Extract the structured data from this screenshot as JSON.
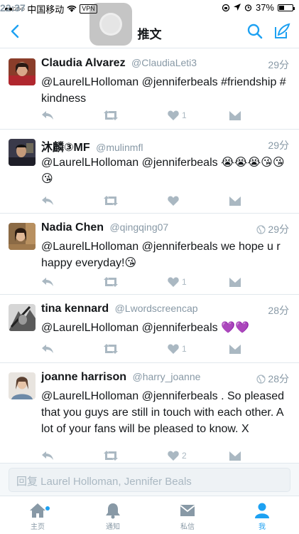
{
  "status_bar": {
    "signal": "●●○○○",
    "carrier": "中国移动",
    "vpn": "VPN",
    "time": "22:37",
    "battery_text": "37%",
    "battery_level": 0.37
  },
  "nav": {
    "title": "推文",
    "accent_color": "#1da1f2"
  },
  "tweets": [
    {
      "name": "Claudia Alvarez",
      "handle": "@ClaudiaLeti3",
      "time": "29分",
      "globe": false,
      "text": "@LaurelLHolloman @jenniferbeals #friendship # kindness",
      "likes": "1",
      "avatar_color": "#8a3d2a"
    },
    {
      "name": "沐麟③MF",
      "handle": "@mulinmfl",
      "time": "29分",
      "globe": false,
      "text": "@LaurelLHolloman @jenniferbeals 😭😭😭😘😘😘",
      "likes": "",
      "avatar_color": "#3a3a4a"
    },
    {
      "name": "Nadia Chen",
      "handle": "@qingqing07",
      "time": "29分",
      "globe": true,
      "text": "@LaurelLHolloman @jenniferbeals we hope u r happy everyday!😘",
      "likes": "1",
      "avatar_color": "#8b6a45"
    },
    {
      "name": "tina kennard",
      "handle": "@Lwordscreencap",
      "time": "28分",
      "globe": false,
      "text": "@LaurelLHolloman @jenniferbeals 💜💜",
      "likes": "1",
      "avatar_color": "#5a5a5a"
    },
    {
      "name": "joanne harrison",
      "handle": "@harry_joanne",
      "time": "28分",
      "globe": true,
      "text": "@LaurelLHolloman @jenniferbeals . So pleased that you guys are still in touch with each other. A lot of your fans will be pleased to know. X",
      "likes": "2",
      "avatar_color": "#c9b8a8"
    }
  ],
  "reply": {
    "placeholder": "回复 Laurel Holloman, Jennifer Beals"
  },
  "tabs": [
    {
      "label": "主页",
      "icon": "home-icon",
      "active": false
    },
    {
      "label": "通知",
      "icon": "bell-icon",
      "active": false
    },
    {
      "label": "私信",
      "icon": "envelope-icon",
      "active": false
    },
    {
      "label": "我",
      "icon": "person-icon",
      "active": true
    }
  ]
}
